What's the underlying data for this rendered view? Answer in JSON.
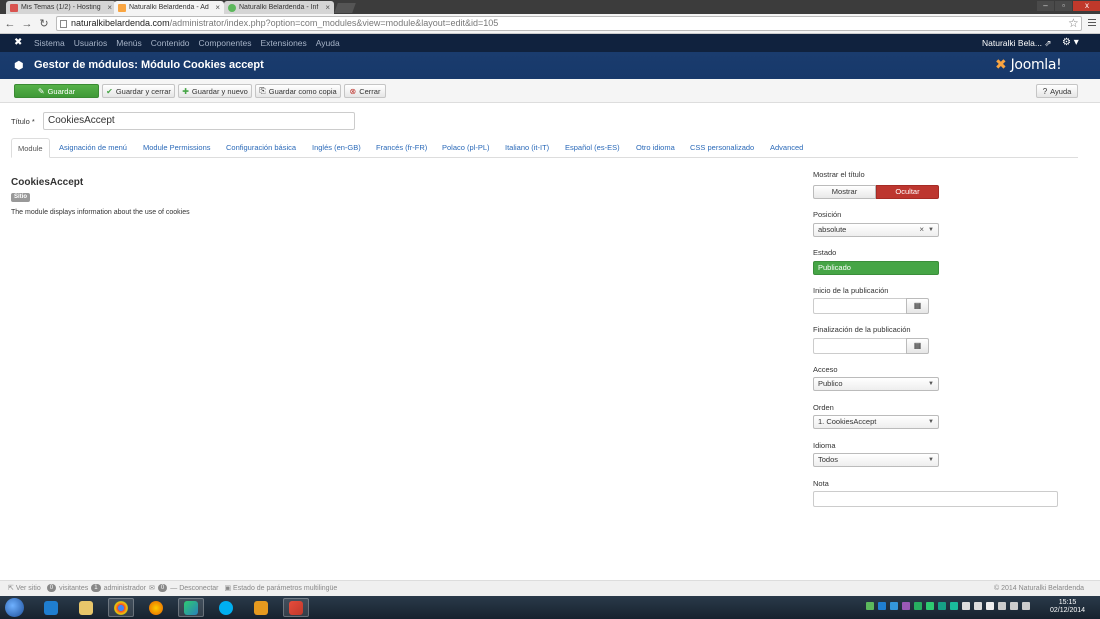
{
  "browser": {
    "tabs": [
      {
        "label": "Mis Temas (1/2) - Hosting",
        "active": false,
        "favicon_color": "#d9534f"
      },
      {
        "label": "Naturalki Belardenda - Ad",
        "active": true,
        "favicon_color": "#f9a541"
      },
      {
        "label": "Naturalki Belardenda - Inf",
        "active": false,
        "favicon_color": "#5cb85c"
      }
    ],
    "tab_close_glyph": "×",
    "url_host": "naturalkibelardenda.com",
    "url_path": "/administrator/index.php?option=com_modules&view=module&layout=edit&id=105",
    "back_glyph": "←",
    "forward_glyph": "→",
    "reload_glyph": "↻",
    "star_glyph": "☆",
    "window_controls": [
      "–",
      "▫",
      "x"
    ]
  },
  "joomla_nav": {
    "logo_glyph": "✖",
    "menu": [
      "Sistema",
      "Usuarios",
      "Menús",
      "Contenido",
      "Componentes",
      "Extensiones",
      "Ayuda"
    ],
    "user": "Naturalki Bela...",
    "user_link_glyph": "⇗",
    "gear_glyph": "⚙ ▾"
  },
  "header": {
    "icon_glyph": "⬢",
    "title": "Gestor de módulos: Módulo Cookies accept",
    "brand_mark": "✖",
    "brand": "Joomla!"
  },
  "toolbar": {
    "save": {
      "label": "Guardar",
      "icon": "✎"
    },
    "save_close": {
      "label": "Guardar y cerrar",
      "icon": "✔"
    },
    "save_new": {
      "label": "Guardar y nuevo",
      "icon": "✚"
    },
    "save_copy": {
      "label": "Guardar como copia",
      "icon": "⎘"
    },
    "close": {
      "label": "Cerrar",
      "icon": "⊗"
    },
    "help": {
      "label": "Ayuda",
      "icon": "?"
    }
  },
  "form": {
    "title_label": "Título *",
    "title_value": "CookiesAccept"
  },
  "tabs": [
    "Module",
    "Asignación de menú",
    "Module Permissions",
    "Configuración básica",
    "Inglés (en-GB)",
    "Francés (fr-FR)",
    "Polaco (pl-PL)",
    "Italiano (it-IT)",
    "Español (es-ES)",
    "Otro idioma",
    "CSS personalizado",
    "Advanced"
  ],
  "module": {
    "name": "CookiesAccept",
    "badge": "Sitio",
    "description": "The module displays information about the use of cookies"
  },
  "sidebar": {
    "show_title_label": "Mostrar el título",
    "show_title_options": [
      "Mostrar",
      "Ocultar"
    ],
    "show_title_selected": "Ocultar",
    "position_label": "Posición",
    "position_value": "absolute",
    "status_label": "Estado",
    "status_value": "Publicado",
    "publish_up_label": "Inicio de la publicación",
    "publish_down_label": "Finalización de la publicación",
    "calendar_glyph": "▦",
    "access_label": "Acceso",
    "access_value": "Publico",
    "order_label": "Orden",
    "order_value": "1. CookiesAccept",
    "language_label": "Idioma",
    "language_value": "Todos",
    "note_label": "Nota",
    "caret_glyph": "▼",
    "clear_glyph": "×"
  },
  "footer": {
    "view_site": "Ver sitio",
    "visitors_count": "0",
    "visitors_label": "visitantes",
    "admins_count": "1",
    "admins_label": "administrador",
    "messages_count": "0",
    "logout": "Desconectar",
    "multilang": "Estado de parámetros multilingüe",
    "copyright": "© 2014 Naturalki Belardenda"
  },
  "taskbar": {
    "time": "15:15",
    "date": "02/12/2014"
  },
  "colors": {
    "joomla_nav": "#10223e",
    "header_blue": "#1a3c6e",
    "save_green": "#46a546",
    "hide_red": "#bd362f"
  }
}
